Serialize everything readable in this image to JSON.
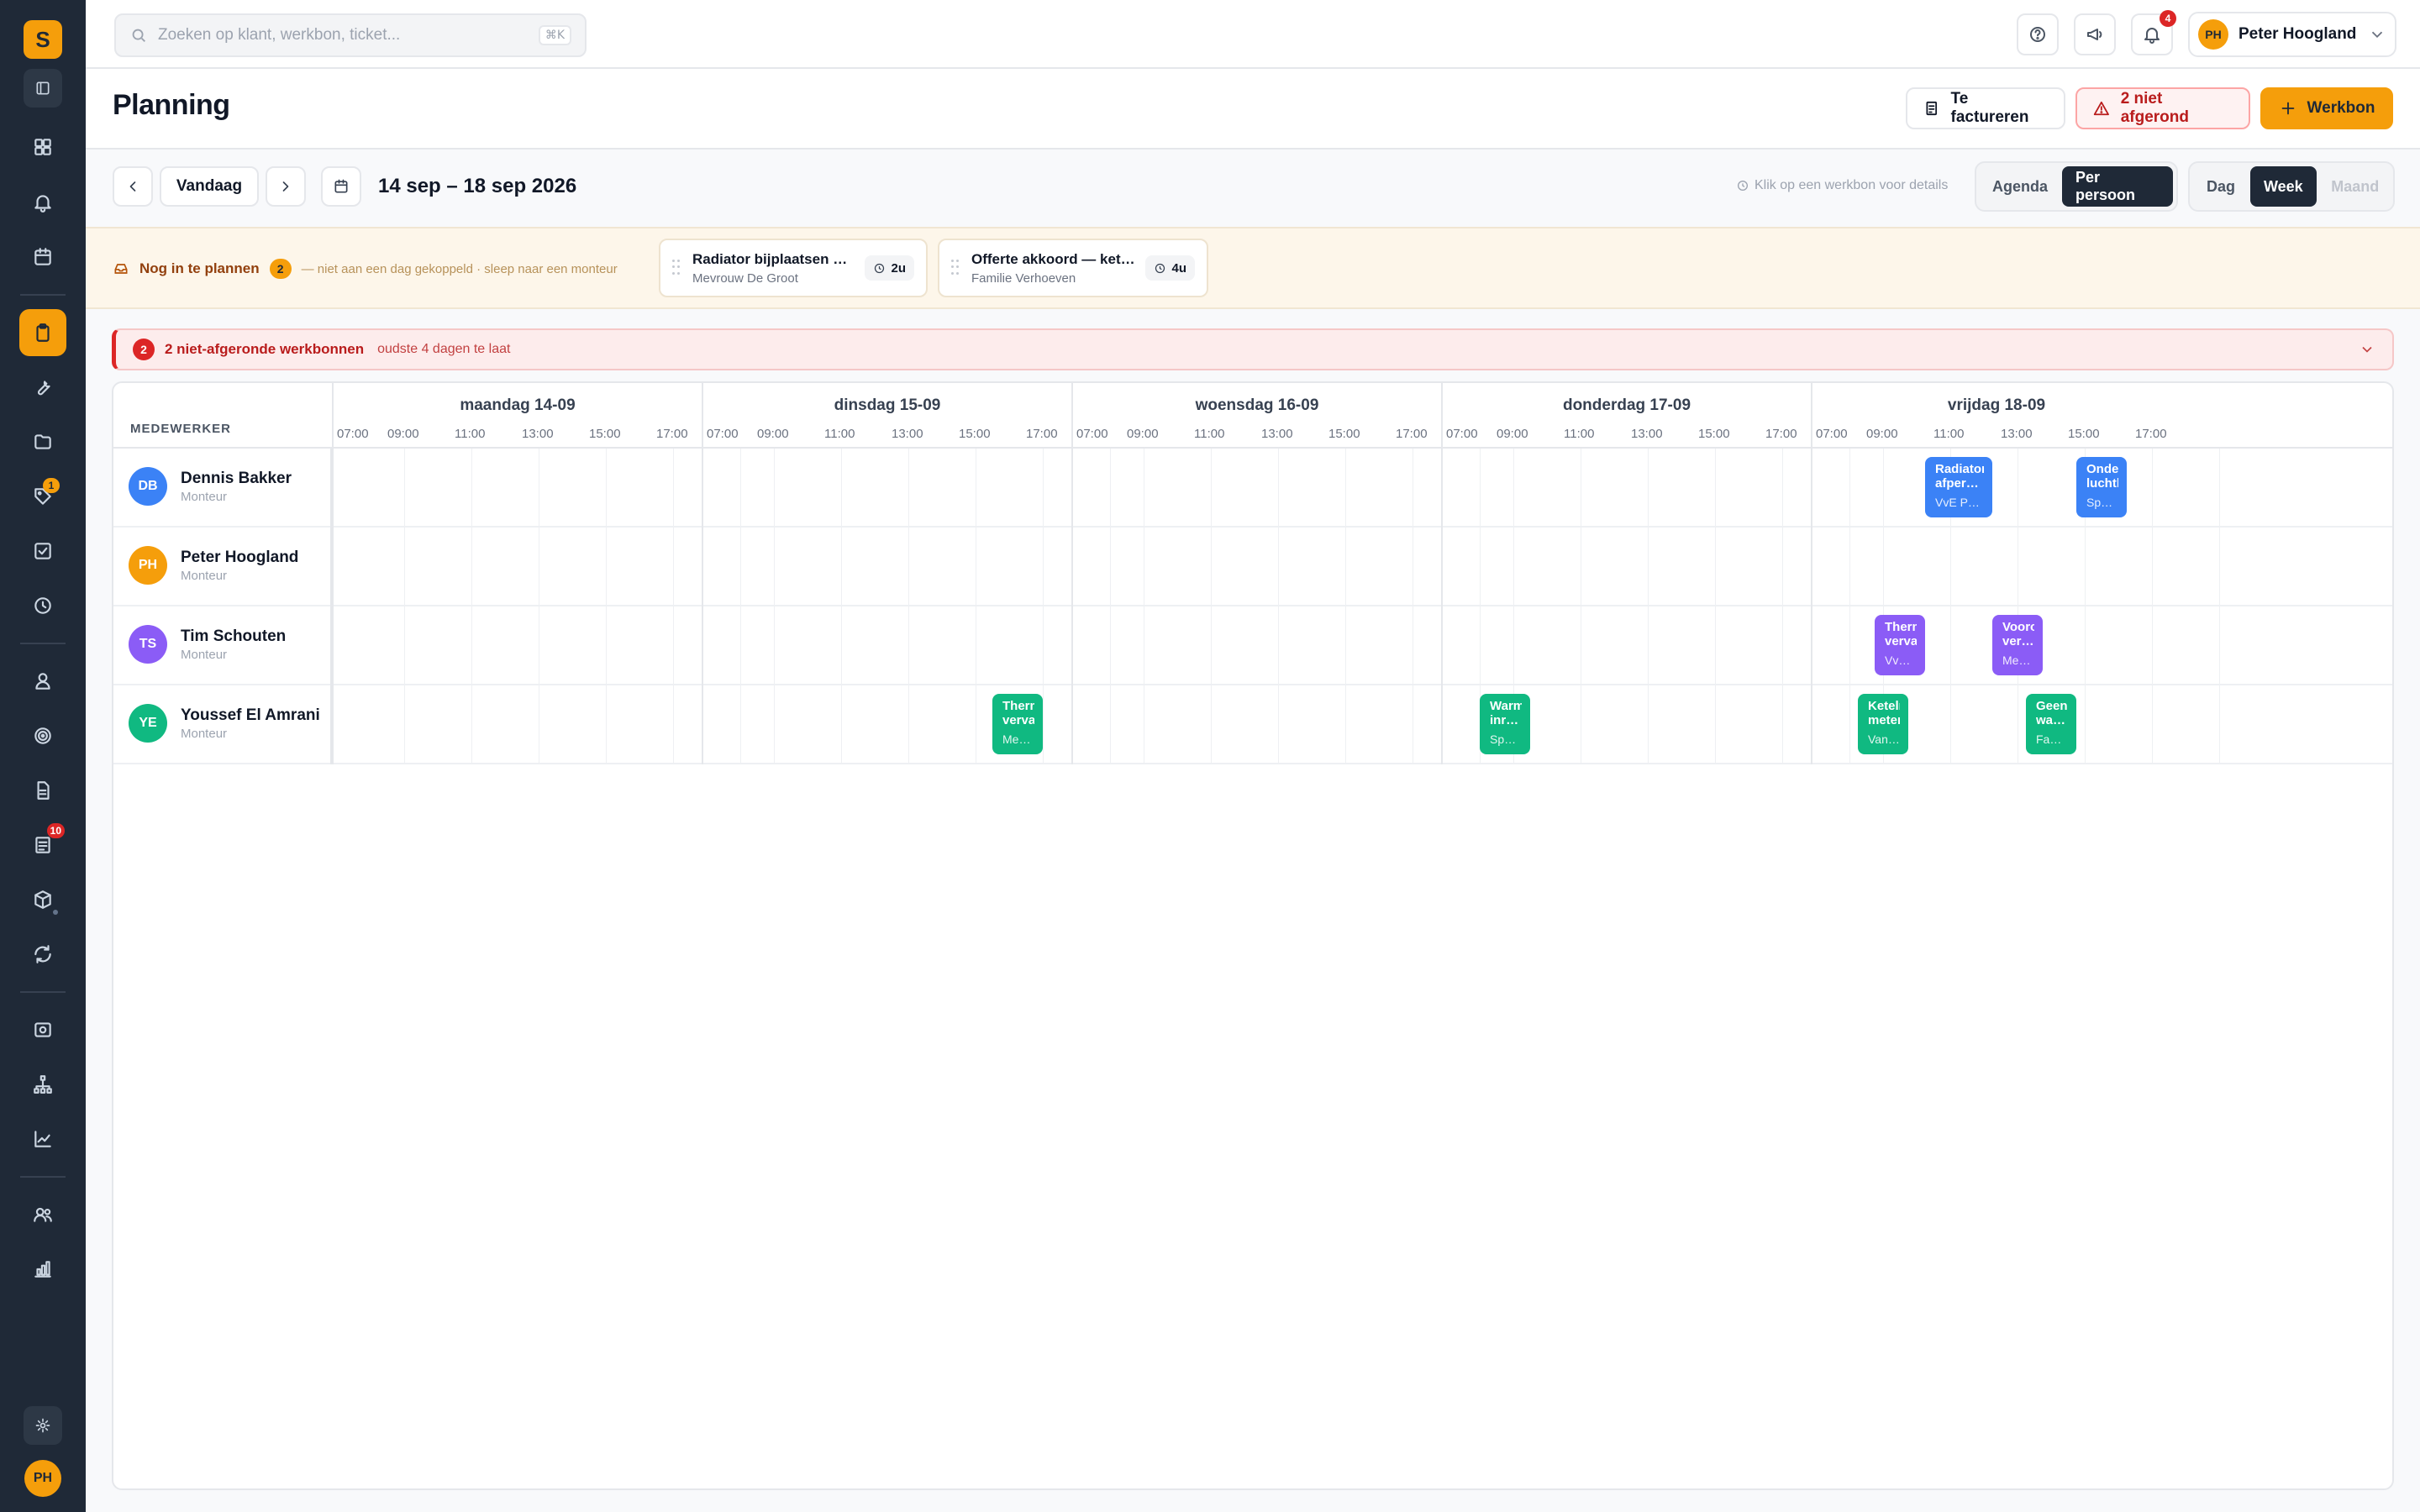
{
  "colors": {
    "accent": "#f59e0b",
    "sidebar": "#1f2937",
    "danger": "#dc2626",
    "dennis": "#3b82f6",
    "peter": "#f59e0b",
    "tim": "#8b5cf6",
    "youssef": "#10b981"
  },
  "sidebar": {
    "logo": "S",
    "tags_badge": "1",
    "docs_badge": "10",
    "avatar": "PH"
  },
  "topbar": {
    "search_placeholder": "Zoeken op klant, werkbon, ticket...",
    "search_shortcut": "⌘K",
    "notifications_count": "4",
    "user_initials": "PH",
    "user_name": "Peter Hoogland"
  },
  "header": {
    "title": "Planning",
    "invoice_label": "Te factureren",
    "unfinished_label": "2 niet afgerond",
    "new_label": "Werkbon"
  },
  "toolbar": {
    "today_label": "Vandaag",
    "date_range": "14 sep – 18 sep 2026",
    "hint": "Klik op een werkbon voor details",
    "view_modes": [
      "Agenda",
      "Per persoon"
    ],
    "active_view": "Per persoon",
    "ranges": [
      "Dag",
      "Week",
      "Maand"
    ],
    "active_range": "Week"
  },
  "unplanned": {
    "title": "Nog in te plannen",
    "count": "2",
    "subtitle": "— niet aan een dag gekoppeld · sleep naar een monteur",
    "cards": [
      {
        "title": "Radiator bijplaatsen woonkamer",
        "client": "Mevrouw De Groot",
        "duration": "2u"
      },
      {
        "title": "Offerte akkoord — ketel vervangen",
        "client": "Familie Verhoeven",
        "duration": "4u"
      }
    ]
  },
  "alert": {
    "count": "2",
    "title": "2 niet-afgeronde werkbonnen",
    "subtitle": "oudste 4 dagen te laat"
  },
  "schedule": {
    "employee_header": "MEDEWERKER",
    "days": [
      "maandag 14-09",
      "dinsdag 15-09",
      "woensdag 16-09",
      "donderdag 17-09",
      "vrijdag 18-09"
    ],
    "hours": [
      "07:00",
      "09:00",
      "11:00",
      "13:00",
      "15:00",
      "17:00"
    ],
    "employees": [
      {
        "initials": "DB",
        "name": "Dennis Bakker",
        "role": "Monteur"
      },
      {
        "initials": "PH",
        "name": "Peter Hoogland",
        "role": "Monteur"
      },
      {
        "initials": "TS",
        "name": "Tim Schouten",
        "role": "Monteur"
      },
      {
        "initials": "YE",
        "name": "Youssef El Amrani",
        "role": "Monteur"
      }
    ],
    "jobs": [
      {
        "employee": 0,
        "day": 4,
        "start": "10:15",
        "end": "12:15",
        "title": "Radiatoren afpersen en ontluchten",
        "client": "VvE Parkhof · Utrecht"
      },
      {
        "employee": 0,
        "day": 4,
        "start": "14:45",
        "end": "16:00",
        "title": "Onderhoud luchtbehandeling",
        "client": "Sporthal De Vliet"
      },
      {
        "employee": 2,
        "day": 4,
        "start": "08:45",
        "end": "10:00",
        "title": "Thermostaat vervangen",
        "client": "VvE Parkhof"
      },
      {
        "employee": 2,
        "day": 4,
        "start": "12:15",
        "end": "13:30",
        "title": "Vooropname vervangen ketel",
        "client": "Mevrouw De Groot"
      },
      {
        "employee": 3,
        "day": 1,
        "start": "15:30",
        "end": "17:00",
        "title": "Thermostaat vervangen",
        "client": "Mevrouw De Groot"
      },
      {
        "employee": 3,
        "day": 3,
        "start": "08:00",
        "end": "09:30",
        "title": "Warmtepomp inregelen na storing",
        "client": "Sporthal De Vliet"
      },
      {
        "employee": 3,
        "day": 4,
        "start": "08:15",
        "end": "09:30",
        "title": "Ketelrendement meten",
        "client": "Van Rooij Bakkerij"
      },
      {
        "employee": 3,
        "day": 4,
        "start": "13:15",
        "end": "14:30",
        "title": "Geen warm water",
        "client": "Familie Verhoeven"
      }
    ]
  }
}
